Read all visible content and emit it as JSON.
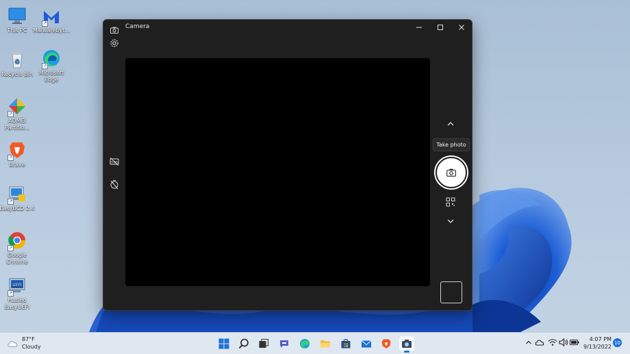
{
  "desktop": {
    "icons": [
      {
        "label": "This PC",
        "icon": "monitor-icon"
      },
      {
        "label": "Malwarebyt...",
        "icon": "malwarebytes-icon"
      },
      {
        "label": "Recycle Bin",
        "icon": "recycle-bin-icon"
      },
      {
        "label": "Microsoft Edge",
        "icon": "edge-icon"
      },
      {
        "label": "AOMEI Partitio...",
        "icon": "aomei-icon"
      },
      {
        "label": "Brave",
        "icon": "brave-icon"
      },
      {
        "label": "EasyBCD 2.4",
        "icon": "easybcd-icon"
      },
      {
        "label": "Google Chrome",
        "icon": "chrome-icon"
      },
      {
        "label": "Hasleo EasyUEFI",
        "icon": "easyuefi-icon"
      }
    ]
  },
  "camera_window": {
    "title": "Camera",
    "tooltip": "Take photo",
    "controls": [
      "settings-icon",
      "hdr-off-icon",
      "timer-off-icon",
      "chevron-up-icon",
      "camera-shutter-icon",
      "qr-code-icon",
      "chevron-down-icon",
      "gallery-thumbnail"
    ]
  },
  "taskbar": {
    "weather": {
      "temp": "87°F",
      "condition": "Cloudy"
    },
    "time": "4:07 PM",
    "date": "9/13/2022",
    "notification_count": "10",
    "pinned": [
      "start-icon",
      "search-icon",
      "task-view-icon",
      "chat-icon",
      "edge-icon",
      "file-explorer-icon",
      "store-icon",
      "mail-icon",
      "brave-icon",
      "camera-icon"
    ],
    "active_app": "camera-icon"
  },
  "colors": {
    "accent": "#1a73d9",
    "window_bg": "#1f1f1f",
    "taskbar_bg": "#dfe7f0"
  }
}
